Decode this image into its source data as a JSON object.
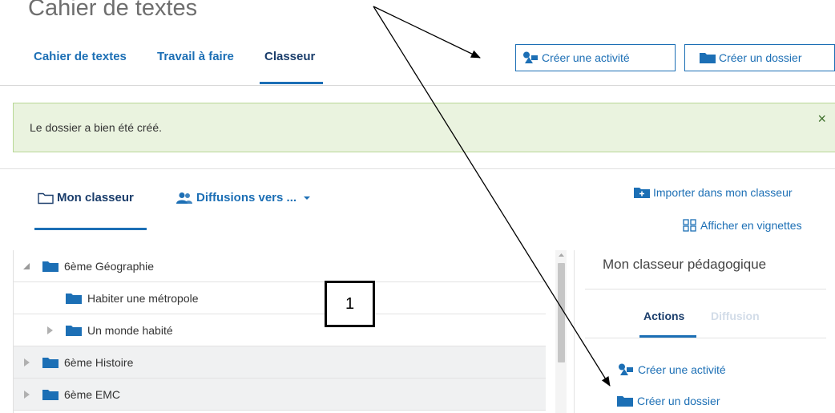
{
  "page": {
    "title": "Cahier de textes"
  },
  "tabs": [
    {
      "label": "Cahier de textes"
    },
    {
      "label": "Travail à faire"
    },
    {
      "label": "Classeur"
    }
  ],
  "toolbar": {
    "create_activity": "Créer une activité",
    "create_folder": "Créer un dossier"
  },
  "alert": {
    "message": "Le dossier a bien été créé.",
    "close": "×"
  },
  "subtabs": {
    "mon_classeur": "Mon classeur",
    "diffusions": "Diffusions vers ..."
  },
  "links": {
    "import": "Importer dans mon classeur",
    "thumbnails": "Afficher en vignettes"
  },
  "tree": [
    {
      "label": "6ème Géographie",
      "expanded": true
    },
    {
      "label": "Habiter une métropole"
    },
    {
      "label": "Un monde habité",
      "expanded": false
    },
    {
      "label": "6ème Histoire",
      "expanded": false
    },
    {
      "label": "6ème EMC",
      "expanded": false
    }
  ],
  "panel": {
    "title": "Mon classeur pédagogique",
    "tab_actions": "Actions",
    "tab_diffusion": "Diffusion",
    "action_create_activity": "Créer une activité",
    "action_create_folder": "Créer un dossier"
  },
  "callout": {
    "label": "1"
  },
  "colors": {
    "primary": "#1c6fb5",
    "primary_dark": "#1a3d6b",
    "success_bg": "#eaf3df",
    "success_border": "#b9d896",
    "row_gray": "#f0f1f2"
  }
}
